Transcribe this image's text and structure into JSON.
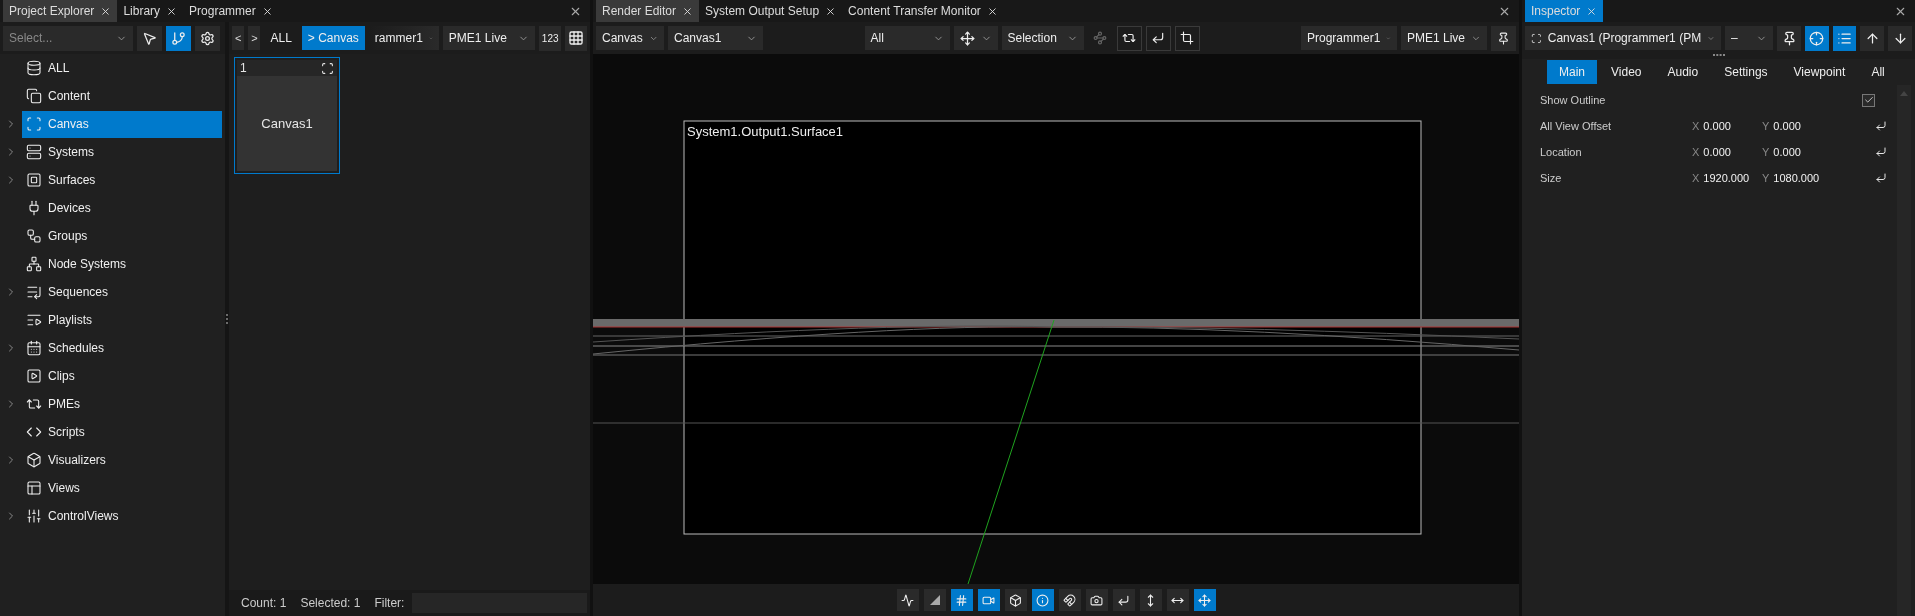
{
  "explorer": {
    "focused": false,
    "tabs": [
      {
        "label": "Project Explorer",
        "selected": true
      },
      {
        "label": "Library",
        "selected": false
      },
      {
        "label": "Programmer",
        "selected": false
      }
    ],
    "sidebar": {
      "select": {
        "placeholder": "Select..."
      },
      "tools": [
        {
          "on": false
        },
        {
          "on": true
        },
        {
          "on": false
        }
      ],
      "items": [
        {
          "label": "ALL",
          "expandable": false,
          "selected": false
        },
        {
          "label": "Content",
          "expandable": false,
          "selected": false
        },
        {
          "label": "Canvas",
          "expandable": true,
          "selected": true
        },
        {
          "label": "Systems",
          "expandable": true,
          "selected": false
        },
        {
          "label": "Surfaces",
          "expandable": true,
          "selected": false
        },
        {
          "label": "Devices",
          "expandable": false,
          "selected": false
        },
        {
          "label": "Groups",
          "expandable": false,
          "selected": false
        },
        {
          "label": "Node Systems",
          "expandable": false,
          "selected": false
        },
        {
          "label": "Sequences",
          "expandable": true,
          "selected": false
        },
        {
          "label": "Playlists",
          "expandable": false,
          "selected": false
        },
        {
          "label": "Schedules",
          "expandable": true,
          "selected": false
        },
        {
          "label": "Clips",
          "expandable": false,
          "selected": false
        },
        {
          "label": "PMEs",
          "expandable": true,
          "selected": false
        },
        {
          "label": "Scripts",
          "expandable": false,
          "selected": false
        },
        {
          "label": "Visualizers",
          "expandable": true,
          "selected": false
        },
        {
          "label": "Views",
          "expandable": false,
          "selected": false
        },
        {
          "label": "ControlViews",
          "expandable": true,
          "selected": false
        }
      ]
    },
    "breadcrumb": {
      "back": "<",
      "forward": ">",
      "crumbs": [
        {
          "label": "ALL",
          "selected": false
        },
        {
          "label": "> Canvas",
          "selected": true
        }
      ],
      "dropdowns": [
        "rammer1",
        "PME1 Live"
      ],
      "number_button": "123"
    },
    "tiles": [
      {
        "number": "1",
        "name": "Canvas1",
        "selected": true
      }
    ],
    "status": {
      "count": "Count: 1",
      "selected": "Selected: 1",
      "filter_label": "Filter:"
    }
  },
  "render": {
    "focused": false,
    "tabs": [
      {
        "label": "Render Editor",
        "selected": true
      },
      {
        "label": "System Output Setup",
        "selected": false
      },
      {
        "label": "Content Transfer Monitor",
        "selected": false
      }
    ],
    "toolbar": {
      "left_dropdowns": [
        "Canvas",
        "Canvas1"
      ],
      "filter": "All",
      "selection": "Selection",
      "right_dropdowns": [
        "Programmer1",
        "PME1 Live"
      ],
      "tools": [
        {
          "disabled": true
        },
        {
          "disabled": false
        },
        {
          "disabled": false
        },
        {
          "disabled": false
        }
      ]
    },
    "surface_label": "System1.Output1.Surface1",
    "view_tools": [
      {
        "on": false
      },
      {
        "on": false
      },
      {
        "on": true
      },
      {
        "on": true
      },
      {
        "on": false
      },
      {
        "on": true
      },
      {
        "on": false
      },
      {
        "on": false
      },
      {
        "on": false
      },
      {
        "on": false
      },
      {
        "on": false
      },
      {
        "on": true
      }
    ]
  },
  "inspector": {
    "focused": true,
    "tabs": [
      {
        "label": "Inspector",
        "selected": true
      }
    ],
    "object": "Canvas1 (Programmer1 (PM",
    "mode": "–",
    "tools": [
      {
        "on": false
      },
      {
        "on": true
      },
      {
        "on": true
      },
      {
        "on": false
      },
      {
        "on": false
      }
    ],
    "subtabs": [
      {
        "label": "Main",
        "selected": true
      },
      {
        "label": "Video",
        "selected": false
      },
      {
        "label": "Audio",
        "selected": false
      },
      {
        "label": "Settings",
        "selected": false
      },
      {
        "label": "Viewpoint",
        "selected": false
      },
      {
        "label": "All",
        "selected": false
      }
    ],
    "properties": [
      {
        "kind": "checkbox",
        "label": "Show Outline",
        "checked": true
      },
      {
        "kind": "vector",
        "label": "All View Offset",
        "values": [
          {
            "axis": "X",
            "value": "0.000"
          },
          {
            "axis": "Y",
            "value": "0.000"
          }
        ]
      },
      {
        "kind": "vector",
        "label": "Location",
        "values": [
          {
            "axis": "X",
            "value": "0.000"
          },
          {
            "axis": "Y",
            "value": "0.000"
          }
        ]
      },
      {
        "kind": "vector",
        "label": "Size",
        "values": [
          {
            "axis": "X",
            "value": "1920.000"
          },
          {
            "axis": "Y",
            "value": "1080.000"
          }
        ]
      }
    ]
  }
}
